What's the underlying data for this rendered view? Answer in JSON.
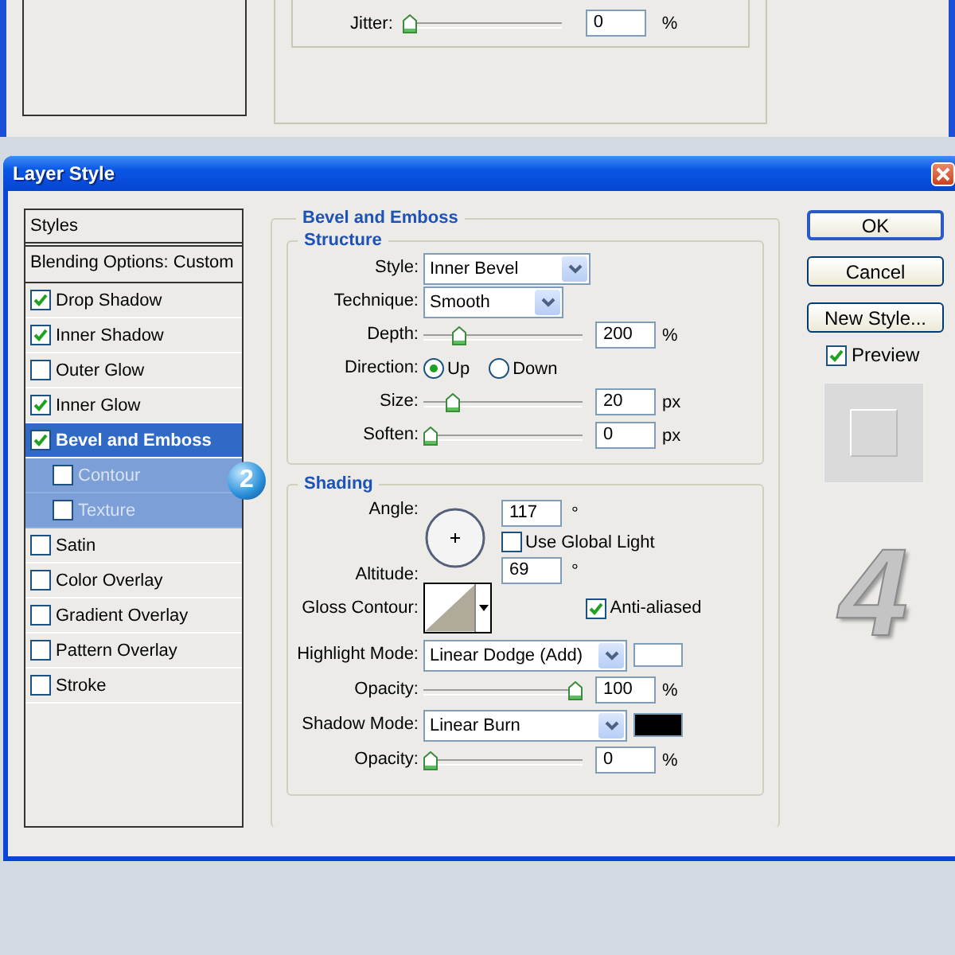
{
  "background_dialog": {
    "jitter": {
      "label": "Jitter:",
      "level": 0,
      "value": "0",
      "unit": "%"
    }
  },
  "window": {
    "title": "Layer Style"
  },
  "styles_panel": {
    "header": "Styles",
    "blending_options": "Blending Options: Custom",
    "items": [
      {
        "label": "Drop Shadow",
        "checked": true,
        "selected": false
      },
      {
        "label": "Inner Shadow",
        "checked": true,
        "selected": false
      },
      {
        "label": "Outer Glow",
        "checked": false,
        "selected": false
      },
      {
        "label": "Inner Glow",
        "checked": true,
        "selected": false
      },
      {
        "label": "Bevel and Emboss",
        "checked": true,
        "selected": true,
        "children": [
          {
            "label": "Contour",
            "checked": false,
            "selected": false
          },
          {
            "label": "Texture",
            "checked": false,
            "selected": false
          }
        ]
      },
      {
        "label": "Satin",
        "checked": false,
        "selected": false
      },
      {
        "label": "Color Overlay",
        "checked": false,
        "selected": false
      },
      {
        "label": "Gradient Overlay",
        "checked": false,
        "selected": false
      },
      {
        "label": "Pattern Overlay",
        "checked": false,
        "selected": false
      },
      {
        "label": "Stroke",
        "checked": false,
        "selected": false
      }
    ]
  },
  "bevel_and_emboss": {
    "title": "Bevel and Emboss",
    "structure": {
      "title": "Structure",
      "rows": [
        {
          "kind": "select",
          "label": "Style:",
          "value": "Inner Bevel"
        },
        {
          "kind": "select",
          "label": "Technique:",
          "value": "Smooth"
        },
        {
          "kind": "slider",
          "label": "Depth:",
          "level": 0.2,
          "value": "200",
          "unit": "%"
        },
        {
          "kind": "radio",
          "label": "Direction:",
          "options": [
            {
              "label": "Up",
              "selected": true
            },
            {
              "label": "Down",
              "selected": false
            }
          ]
        },
        {
          "kind": "slider",
          "label": "Size:",
          "level": 0.15,
          "value": "20",
          "unit": "px"
        },
        {
          "kind": "slider",
          "label": "Soften:",
          "level": 0,
          "value": "0",
          "unit": "px"
        }
      ]
    },
    "shading": {
      "title": "Shading",
      "angle": {
        "label": "Angle:",
        "value": "117",
        "unit": "°"
      },
      "use_global_light": {
        "label": "Use Global Light",
        "checked": false
      },
      "altitude": {
        "label": "Altitude:",
        "value": "69",
        "unit": "°"
      },
      "gloss_contour": {
        "label": "Gloss Contour:"
      },
      "anti_aliased": {
        "label": "Anti-aliased",
        "checked": true
      },
      "rows": [
        {
          "kind": "select",
          "label": "Highlight Mode:",
          "value": "Linear Dodge (Add)",
          "color": "#ffffff"
        },
        {
          "kind": "slider",
          "label": "Opacity:",
          "level": 1,
          "value": "100",
          "unit": "%"
        },
        {
          "kind": "select",
          "label": "Shadow Mode:",
          "value": "Linear Burn",
          "color": "#000000"
        },
        {
          "kind": "slider",
          "label": "Opacity:",
          "level": 0,
          "value": "0",
          "unit": "%"
        }
      ]
    }
  },
  "buttons": [
    {
      "label": "OK",
      "default": true
    },
    {
      "label": "Cancel",
      "default": false
    },
    {
      "label": "New Style...",
      "default": false
    }
  ],
  "preview": {
    "label": "Preview",
    "checked": true
  },
  "step_markers": [
    "2",
    "4"
  ]
}
